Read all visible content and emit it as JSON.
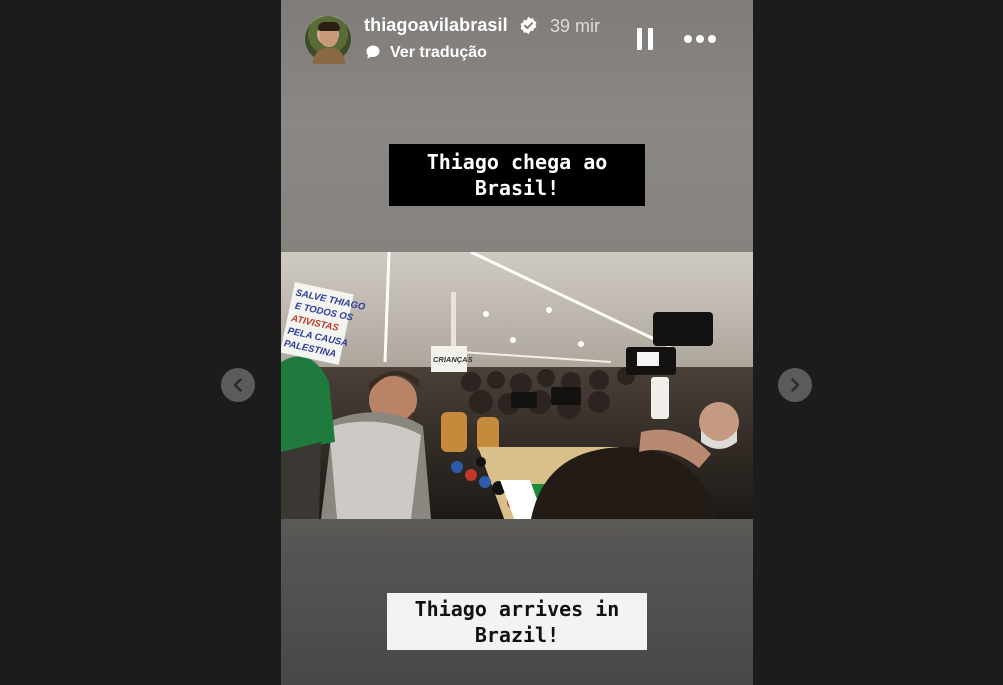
{
  "story": {
    "username": "thiagoavilabrasil",
    "time": "39 mir",
    "translate_label": "Ver tradução",
    "caption_top": "Thiago chega ao\nBrasil!",
    "caption_bottom": "Thiago arrives in\nBrazil!",
    "photo": {
      "sign_left": [
        "SALVE THIAGO",
        "E TODOS OS",
        "ATIVISTAS",
        "PELA CAUSA",
        "PALESTINA"
      ],
      "sign_center": [
        "CRIANÇAS"
      ]
    }
  },
  "icons": {
    "verified": "verified-badge-icon",
    "translate": "speech-bubble-icon",
    "pause": "pause-icon",
    "more": "more-options-icon",
    "prev": "chevron-left-icon",
    "next": "chevron-right-icon"
  },
  "colors": {
    "page_background": "#1c1c1c",
    "caption_top_bg": "#000000",
    "caption_bottom_bg": "#f3f3f3",
    "verified": "#ffffff"
  }
}
